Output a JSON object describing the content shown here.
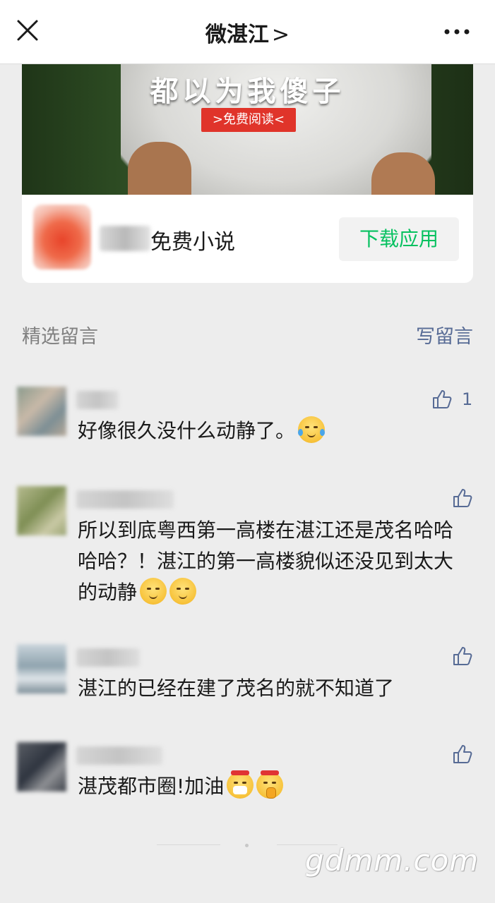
{
  "topbar": {
    "title": "微湛江",
    "title_chevron": ">",
    "close_icon": "close-icon",
    "more_icon": "more-icon"
  },
  "ad": {
    "headline": "都以为我傻子",
    "read_button": ">免费阅读<",
    "app_name": "免费小说",
    "download_button": "下载应用"
  },
  "comments_section": {
    "label": "精选留言",
    "write_label": "写留言"
  },
  "comments": [
    {
      "text": "好像很久没什么动静了。",
      "likes": "1"
    },
    {
      "text": "所以到底粤西第一高楼在湛江还是茂名哈哈哈哈？！湛江的第一高楼貌似还没见到太大的动静",
      "likes": ""
    },
    {
      "text": "湛江的已经在建了茂名的就不知道了",
      "likes": ""
    },
    {
      "text": "湛茂都市圈!加油",
      "likes": ""
    }
  ],
  "watermark": "gdmm.com",
  "colors": {
    "link": "#576b95",
    "accent_green": "#07c160",
    "ad_red": "#e0342a",
    "background": "#ededed"
  }
}
